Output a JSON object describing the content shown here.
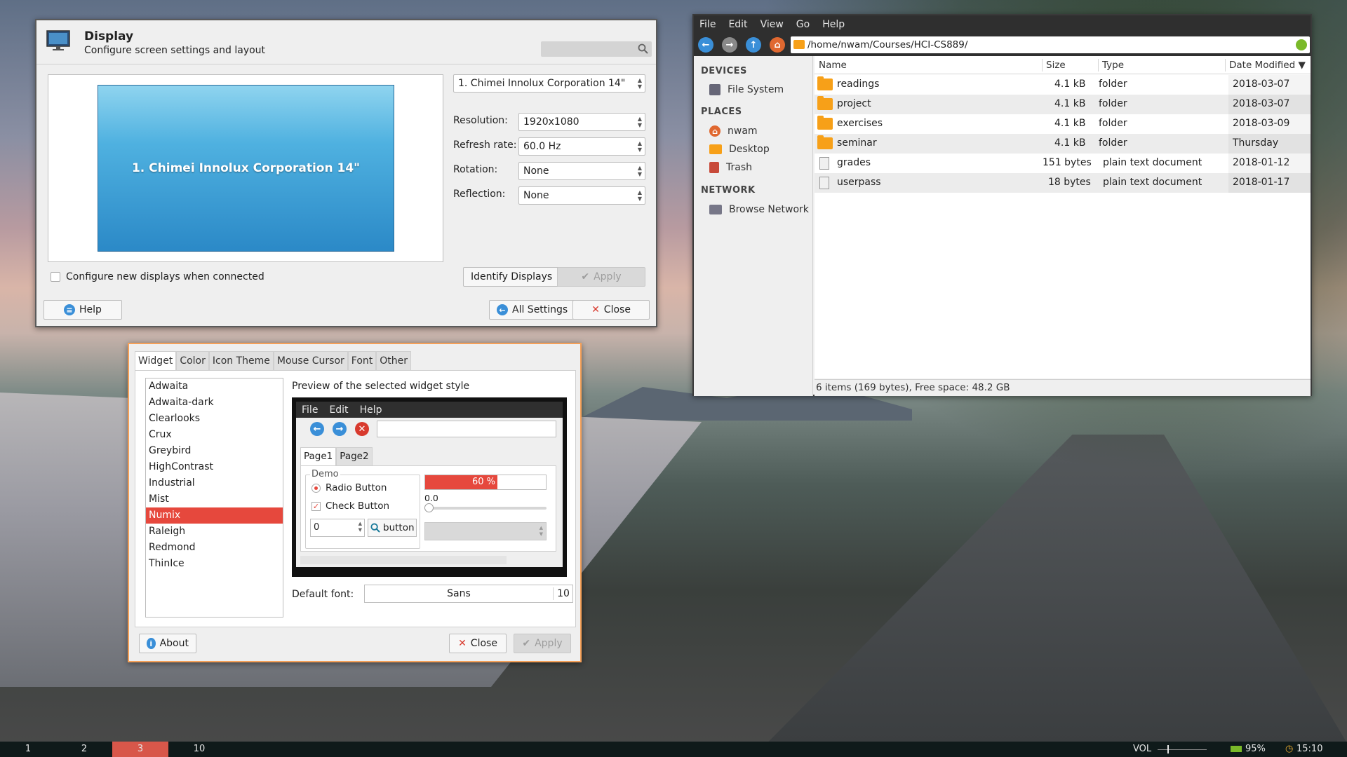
{
  "display": {
    "title": "Display",
    "subtitle": "Configure screen settings and layout",
    "search_placeholder": "",
    "monitor_label": "1. Chimei Innolux Corporation 14\"",
    "monitor_select": "1. Chimei Innolux Corporation 14\"",
    "resolution_label": "Resolution:",
    "resolution_value": "1920x1080",
    "refresh_label": "Refresh rate:",
    "refresh_value": "60.0 Hz",
    "rotation_label": "Rotation:",
    "rotation_value": "None",
    "reflection_label": "Reflection:",
    "reflection_value": "None",
    "configure_new": "Configure new displays when connected",
    "identify_label": "Identify Displays",
    "apply_label": "Apply",
    "help_label": "Help",
    "all_settings_label": "All Settings",
    "close_label": "Close"
  },
  "file_manager": {
    "menu": [
      "File",
      "Edit",
      "View",
      "Go",
      "Help"
    ],
    "path": "/home/nwam/Courses/HCI-CS889/",
    "sidebar": {
      "devices_header": "DEVICES",
      "devices": [
        "File System"
      ],
      "places_header": "PLACES",
      "places": [
        "nwam",
        "Desktop",
        "Trash"
      ],
      "network_header": "NETWORK",
      "network": [
        "Browse Network"
      ]
    },
    "columns": {
      "name": "Name",
      "size": "Size",
      "type": "Type",
      "date": "Date Modified ▼"
    },
    "rows": [
      {
        "name": "readings",
        "size": "4.1 kB",
        "type": "folder",
        "date": "2018-03-07",
        "kind": "folder"
      },
      {
        "name": "project",
        "size": "4.1 kB",
        "type": "folder",
        "date": "2018-03-07",
        "kind": "folder"
      },
      {
        "name": "exercises",
        "size": "4.1 kB",
        "type": "folder",
        "date": "2018-03-09",
        "kind": "folder"
      },
      {
        "name": "seminar",
        "size": "4.1 kB",
        "type": "folder",
        "date": "Thursday",
        "kind": "folder"
      },
      {
        "name": "grades",
        "size": "151 bytes",
        "type": "plain text document",
        "date": "2018-01-12",
        "kind": "doc"
      },
      {
        "name": "userpass",
        "size": "18 bytes",
        "type": "plain text document",
        "date": "2018-01-17",
        "kind": "doc"
      }
    ],
    "status": "6 items (169 bytes), Free space: 48.2 GB"
  },
  "appearance": {
    "tabs": [
      "Widget",
      "Color",
      "Icon Theme",
      "Mouse Cursor",
      "Font",
      "Other"
    ],
    "themes": [
      "Adwaita",
      "Adwaita-dark",
      "Clearlooks",
      "Crux",
      "Greybird",
      "HighContrast",
      "Industrial",
      "Mist",
      "Numix",
      "Raleigh",
      "Redmond",
      "ThinIce"
    ],
    "selected_theme": "Numix",
    "preview_title": "Preview of the selected widget style",
    "demo": {
      "menu": [
        "File",
        "Edit",
        "Help"
      ],
      "tabs": [
        "Page1",
        "Page2"
      ],
      "group_label": "Demo",
      "radio_label": "Radio Button",
      "check_label": "Check Button",
      "spin_value": "0",
      "button_label": "button",
      "progress": 0.6,
      "progress_text": "60 %",
      "scale_value": "0.0"
    },
    "default_font_label": "Default font:",
    "font_name": "Sans",
    "font_size": "10",
    "about_label": "About",
    "close_label": "Close",
    "apply_label": "Apply"
  },
  "taskbar": {
    "workspaces": [
      "1",
      "2",
      "3",
      "10"
    ],
    "active_workspace": "3",
    "vol_label": "VOL",
    "battery": "95%",
    "clock": "15:10"
  },
  "colors": {
    "accent": "#e6483d",
    "taskbar": "#0f1a1a",
    "folder": "#f7a018",
    "blue": "#3a8fd8"
  }
}
